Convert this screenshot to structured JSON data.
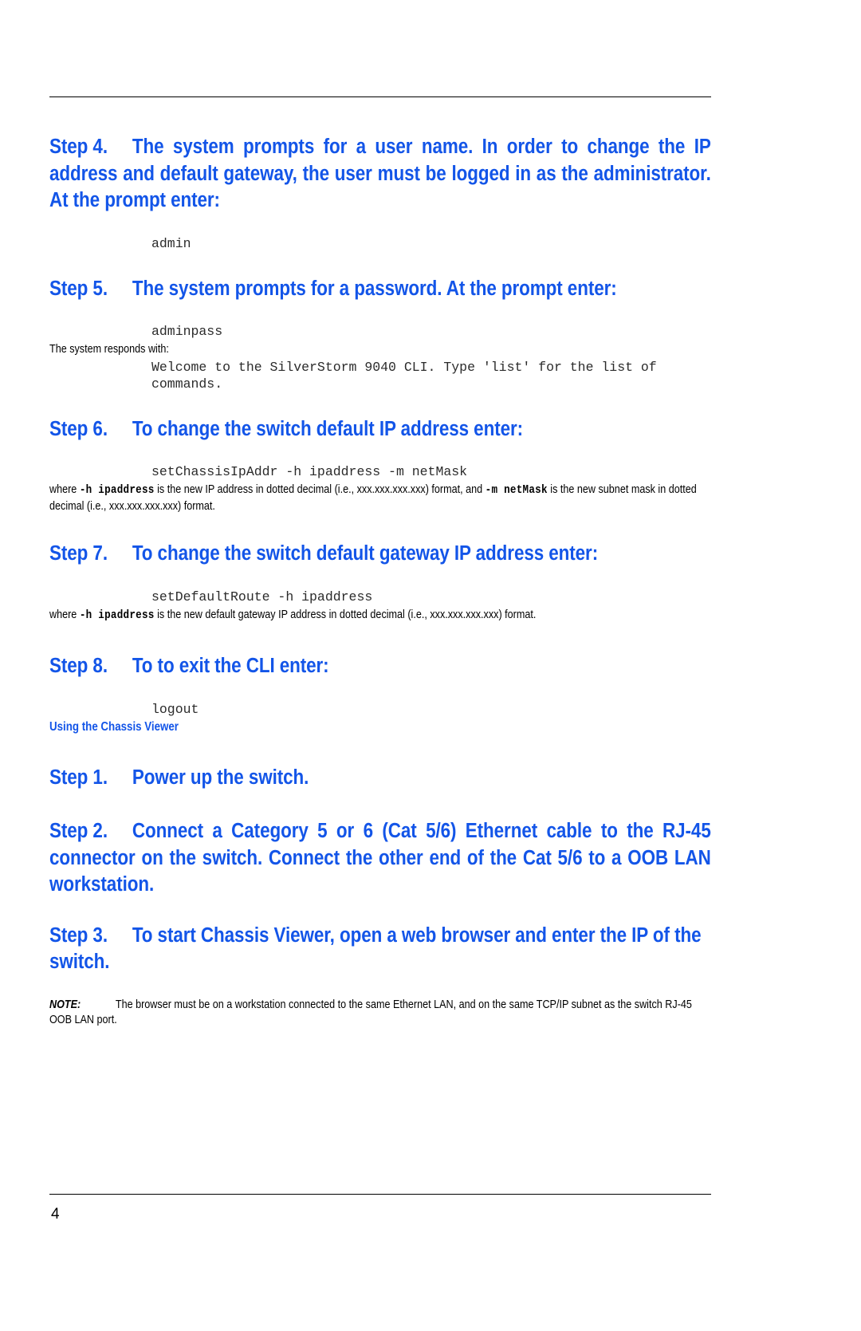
{
  "document": {
    "page_number": "4",
    "accent_color": "#1355E8",
    "text_color": "#000000"
  },
  "steps": [
    {
      "number": "Step 4.",
      "text": "The system prompts for a user name. In order to change the IP address and default gateway, the user must be logged in as the administrator. At the prompt enter:",
      "code": "admin"
    },
    {
      "number": "Step 5.",
      "text": "The system prompts for a password. At the prompt enter:",
      "code": "adminpass",
      "responds_label": "The system responds with:",
      "response": "Welcome to the SilverStorm 9040 CLI. Type 'list' for the list of\ncommands."
    },
    {
      "number": "Step 6.",
      "text": "To change the switch default IP address enter:",
      "code": "setChassisIpAddr -h ipaddress -m netMask",
      "where_1": "where ",
      "where_mono_1": "-h ipaddress",
      "where_2": " is the new IP address in dotted decimal (i.e., xxx.xxx.xxx.xxx) format, and ",
      "where_mono_2": "-m netMask",
      "where_3": " is the new subnet mask in dotted decimal (i.e., xxx.xxx.xxx.xxx) format."
    },
    {
      "number": "Step 7.",
      "text": "To change the switch default gateway IP address enter:",
      "code": "setDefaultRoute -h ipaddress",
      "where_1": "where ",
      "where_mono_1": "-h ipaddress",
      "where_2": " is the new default gateway IP address in dotted decimal (i.e., xxx.xxx.xxx.xxx) format."
    },
    {
      "number": "Step 8.",
      "text": "To to exit the CLI enter:",
      "code": "logout"
    }
  ],
  "section": {
    "heading": "Using the Chassis Viewer",
    "steps": [
      {
        "number": "Step 1.",
        "text": "Power up the switch."
      },
      {
        "number": "Step 2.",
        "text": "Connect a Category 5 or 6 (Cat 5/6) Ethernet cable to the RJ-45 connector on the switch. Connect the other end of the Cat 5/6 to a OOB LAN workstation."
      },
      {
        "number": "Step 3.",
        "text": "To start Chassis Viewer, open a web browser and enter the IP of the switch."
      }
    ],
    "note_label": "NOTE:",
    "note_text": "The browser must be on a workstation connected to the same Ethernet LAN, and on the same TCP/IP subnet as the switch RJ-45 OOB LAN port."
  }
}
